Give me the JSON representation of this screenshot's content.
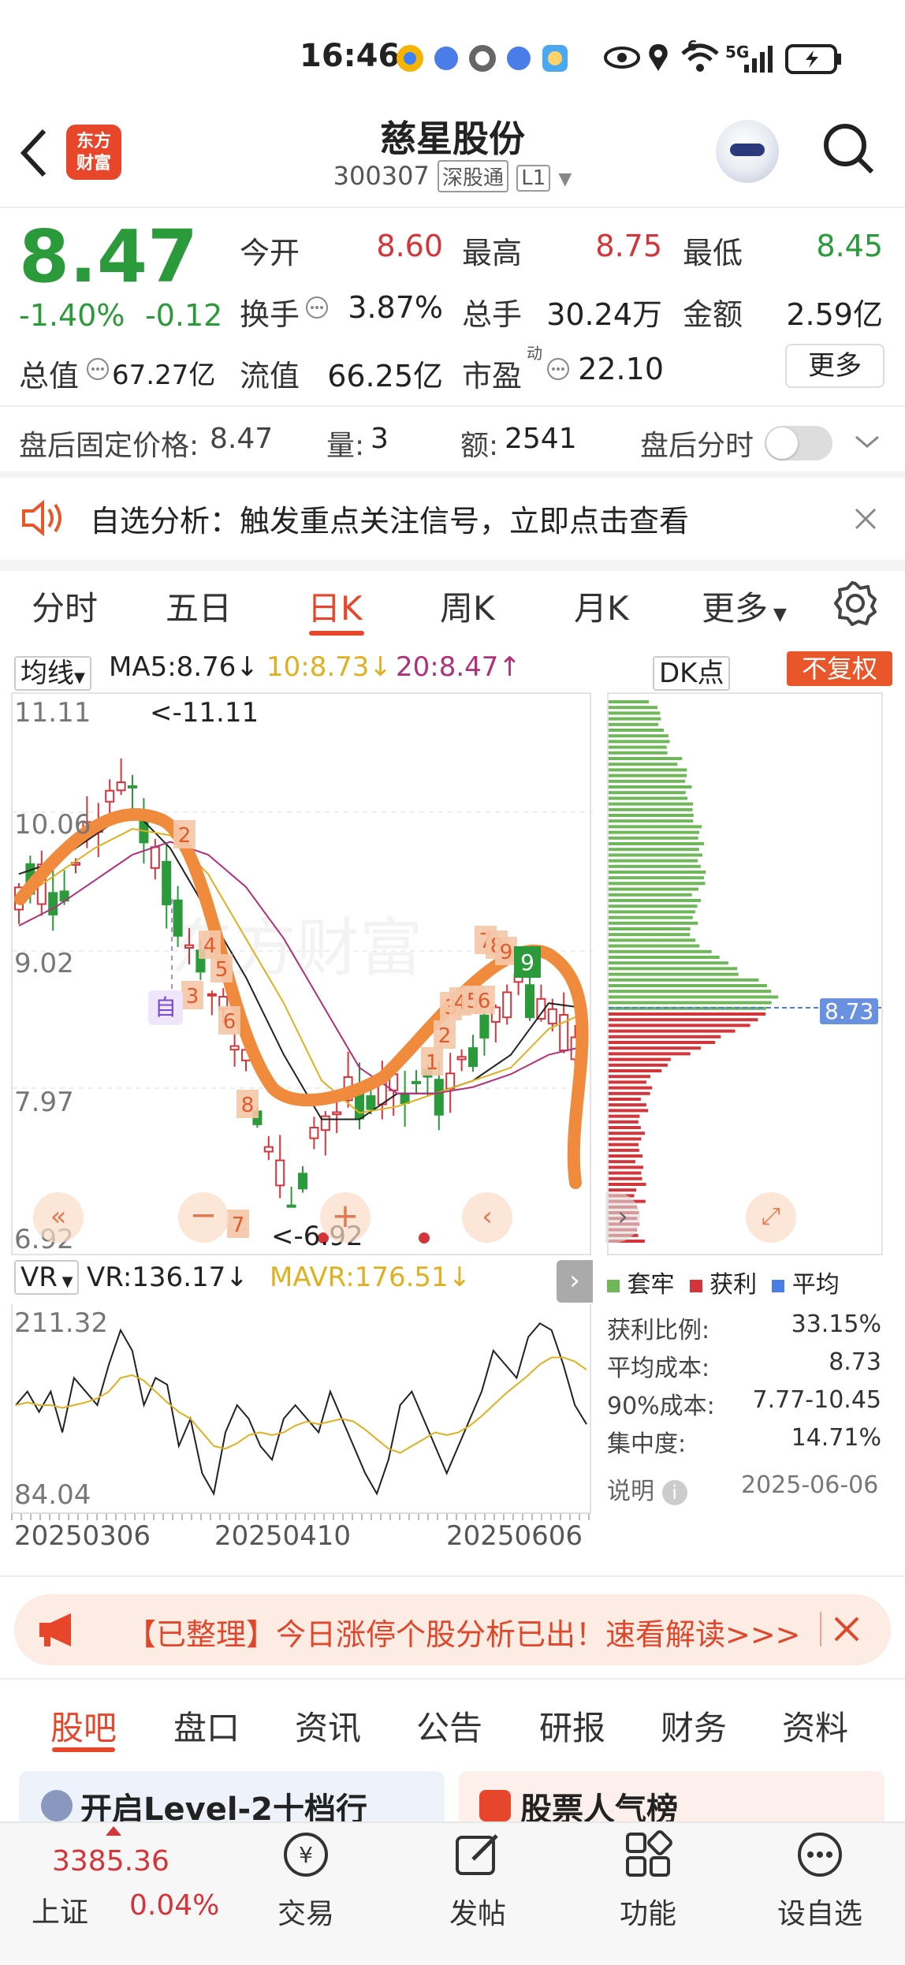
{
  "status_bar": {
    "time": "16:46",
    "network": "5G",
    "sig_badge": "6"
  },
  "header": {
    "name": "慈星股份",
    "code": "300307",
    "exchange_tag": "深股通",
    "level_tag": "L1",
    "logo_line1": "东方",
    "logo_line2": "财富"
  },
  "quote": {
    "price": "8.47",
    "change_pct": "-1.40%",
    "change_amt": "-0.12",
    "open_label": "今开",
    "open": "8.60",
    "high_label": "最高",
    "high": "8.75",
    "low_label": "最低",
    "low": "8.45",
    "turnover_label": "换手",
    "turnover": "3.87%",
    "volume_label": "总手",
    "volume": "30.24万",
    "amount_label": "金额",
    "amount": "2.59亿",
    "mktcap_label": "总值",
    "mktcap": "67.27亿",
    "float_label": "流值",
    "float": "66.25亿",
    "pe_label": "市盈",
    "pe_sup": "动",
    "pe": "22.10",
    "more": "更多"
  },
  "after_hours": {
    "price_label": "盘后固定价格:",
    "price": "8.47",
    "vol_label": "量:",
    "vol": "3",
    "amt_label": "额:",
    "amt": "2541",
    "toggle_label": "盘后分时"
  },
  "notice": {
    "text": "自选分析：触发重点关注信号，立即点击查看"
  },
  "tabs": [
    "分时",
    "五日",
    "日K",
    "周K",
    "月K",
    "更多"
  ],
  "ma_row": {
    "selector": "均线",
    "ma5": "MA5:8.76",
    "ma10": "10:8.73",
    "ma20": "20:8.47",
    "dk": "DK点",
    "fq": "不复权"
  },
  "chart": {
    "y_labels": [
      "11.11",
      "10.06",
      "9.02",
      "7.97",
      "6.92"
    ],
    "max_note": "<-11.11",
    "min_note": "<-6.92",
    "markers": [
      "2",
      "4",
      "5",
      "3",
      "6",
      "8",
      "7",
      "1",
      "2",
      "3",
      "4",
      "5",
      "6",
      "7",
      "8",
      "9"
    ],
    "self_tag": "自",
    "watermark": "东方财富",
    "avg_cost_tag": "8.73"
  },
  "vr": {
    "selector": "VR",
    "vr": "VR:136.17",
    "mavr": "MAVR:176.51",
    "y_top": "211.32",
    "y_bottom": "84.04"
  },
  "dates": [
    "20250306",
    "20250410",
    "20250606"
  ],
  "legend": {
    "trapped": "套牢",
    "profit": "获利",
    "avg": "平均"
  },
  "stats": [
    {
      "label": "获利比例:",
      "value": "33.15%"
    },
    {
      "label": "平均成本:",
      "value": "8.73"
    },
    {
      "label": "90%成本:",
      "value": "7.77-10.45"
    },
    {
      "label": "集中度:",
      "value": "14.71%"
    }
  ],
  "note": {
    "label": "说明",
    "date": "2025-06-06"
  },
  "banner": {
    "text": "【已整理】今日涨停个股分析已出！速看解读>>>"
  },
  "bottom_tabs": [
    "股吧",
    "盘口",
    "资讯",
    "公告",
    "研报",
    "财务",
    "资料"
  ],
  "cards": [
    "开启Level-2十档行",
    "股票人气榜"
  ],
  "index": {
    "value": "3385.36",
    "name": "上证",
    "pct": "0.04%"
  },
  "nav": [
    "交易",
    "发帖",
    "功能",
    "设自选"
  ],
  "colors": {
    "up": "#d4353a",
    "down": "#2a9a3a",
    "brand": "#e8462a",
    "annotation": "#f08a3c"
  }
}
